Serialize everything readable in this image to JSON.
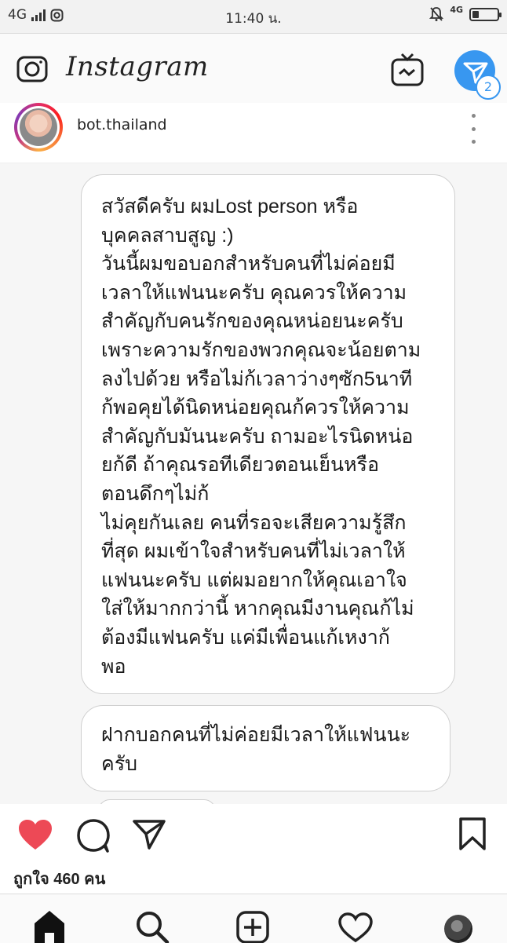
{
  "status_bar": {
    "network": "4G",
    "time": "11:40 น.",
    "net_small": "4G",
    "battery_level_percent": 25
  },
  "app_header": {
    "title": "Instagram",
    "dm_badge_count": "2"
  },
  "post": {
    "username": "bot.thailand",
    "messages": [
      "สวัสดีครับ ผมLost person หรือ\nบุคคลสาบสูญ :)\nวันนี้ผมขอบอกสำหรับคนที่ไม่ค่อยมี\nเวลาให้แฟนนะครับ  คุณควรให้ความ\nสำคัญกับคนรักของคุณหน่อยนะครับ\nเพราะความรักของพวกคุณจะน้อยตาม\nลงไปด้วย หรือไม่ก้เวลาว่างๆซัก5นาที\nก้พอคุยได้นิดหน่อยคุณก้ควรให้ความ\nสำคัญกับมันนะครับ ถามอะไรนิดหน่อ\nยก้ดี ถ้าคุณรอทีเดียวตอนเย็นหรือ\nตอนดึกๆไม่ก้\nไม่คุยกันเลย คนที่รอจะเสียความรู้สึก\nที่สุด ผมเข้าใจสำหรับคนที่ไม่เวลาให้\nแฟนนะครับ แต่ผมอยากให้คุณเอาใจ\nใส่ให้มากกว่านี้ หากคุณมีงานคุณก้ไม่\nต้องมีแฟนครับ แค่มีเพื่อนแก้เหงาก้\nพอ",
      "ฝากบอกคนที่ไม่ค่อยมีเวลาให้แฟนนะ\nครับ"
    ],
    "likes_text": "ถูกใจ 460 คน"
  },
  "icons": {
    "camera": "camera-icon",
    "igtv": "igtv-icon",
    "direct": "direct-message-icon",
    "more": "more-options-icon",
    "like": "heart-filled-icon",
    "comment": "comment-icon",
    "share": "share-icon",
    "save": "bookmark-icon",
    "home": "home-icon",
    "search": "search-icon",
    "new_post": "add-post-icon",
    "activity": "heart-outline-icon",
    "profile": "profile-avatar"
  },
  "colors": {
    "like_red": "#ed4956",
    "dm_blue": "#3897f0"
  }
}
